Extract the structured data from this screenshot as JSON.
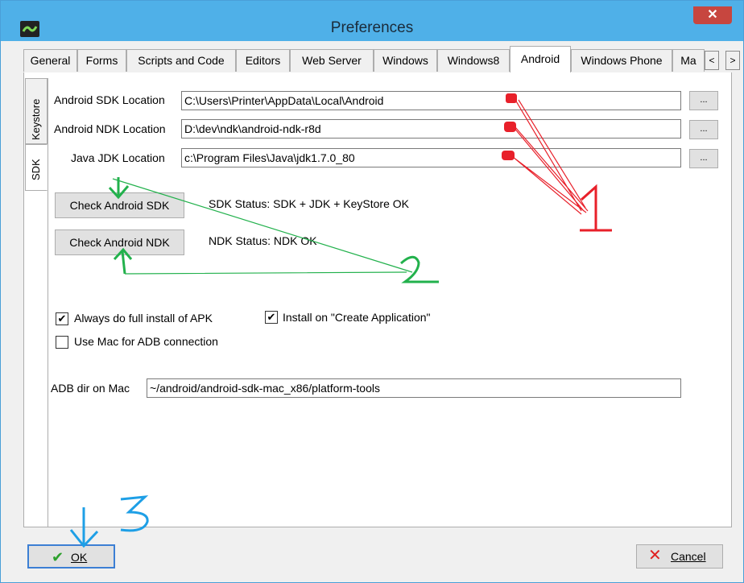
{
  "window": {
    "title": "Preferences",
    "close_glyph": "✕"
  },
  "tabs": [
    {
      "label": "General",
      "active": false
    },
    {
      "label": "Forms",
      "active": false
    },
    {
      "label": "Scripts and Code",
      "active": false
    },
    {
      "label": "Editors",
      "active": false
    },
    {
      "label": "Web Server",
      "active": false
    },
    {
      "label": "Windows",
      "active": false
    },
    {
      "label": "Windows8",
      "active": false
    },
    {
      "label": "Android",
      "active": true
    },
    {
      "label": "Windows Phone",
      "active": false
    },
    {
      "label": "Ma",
      "active": false
    }
  ],
  "tab_scroll": {
    "left": "<",
    "right": ">"
  },
  "side_tabs": [
    {
      "label": "Keystore",
      "active": false
    },
    {
      "label": "SDK",
      "active": true
    }
  ],
  "locations": [
    {
      "label": "Android SDK Location",
      "value": "C:\\Users\\Printer\\AppData\\Local\\Android",
      "browse": "..."
    },
    {
      "label": "Android NDK Location",
      "value": "D:\\dev\\ndk\\android-ndk-r8d",
      "browse": "..."
    },
    {
      "label": "Java JDK Location",
      "value": "c:\\Program Files\\Java\\jdk1.7.0_80",
      "browse": "..."
    }
  ],
  "checks": {
    "sdk_button": "Check Android SDK",
    "sdk_status": "SDK Status:  SDK + JDK + KeyStore OK",
    "ndk_button": "Check Android NDK",
    "ndk_status": "NDK Status:  NDK OK"
  },
  "options": [
    {
      "label": "Always do full install of APK",
      "checked": true
    },
    {
      "label": "Install on \"Create Application\"",
      "checked": true
    },
    {
      "label": "Use Mac for ADB connection",
      "checked": false
    }
  ],
  "adb": {
    "label": "ADB dir on Mac",
    "value": "~/android/android-sdk-mac_x86/platform-tools"
  },
  "footer": {
    "ok_label": "OK",
    "cancel_label": "Cancel"
  },
  "annotations": {
    "one": "1",
    "two": "2",
    "three": "3"
  },
  "colors": {
    "titlebar": "#4fb0e8",
    "red_ink": "#e8202a",
    "green_ink": "#22b14c",
    "blue_ink": "#1e9fe6"
  }
}
